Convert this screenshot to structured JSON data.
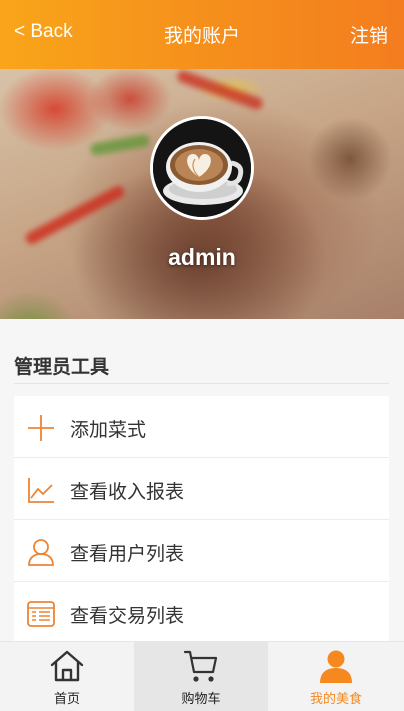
{
  "header": {
    "back_label": "< Back",
    "title": "我的账户",
    "logout_label": "注销"
  },
  "profile": {
    "username": "admin"
  },
  "admin_tools": {
    "section_title": "管理员工具",
    "items": [
      {
        "label": "添加菜式",
        "icon": "plus-icon"
      },
      {
        "label": "查看收入报表",
        "icon": "line-chart-icon"
      },
      {
        "label": "查看用户列表",
        "icon": "user-icon"
      },
      {
        "label": "查看交易列表",
        "icon": "list-table-icon"
      }
    ]
  },
  "tabbar": {
    "tabs": [
      {
        "label": "首页",
        "icon": "home-icon"
      },
      {
        "label": "购物车",
        "icon": "cart-icon"
      },
      {
        "label": "我的美食",
        "icon": "profile-icon",
        "active": true
      }
    ]
  },
  "colors": {
    "accent": "#f5891f",
    "header_start": "#f9a51a",
    "header_end": "#f47d1f",
    "icon_orange": "#ee8433"
  }
}
